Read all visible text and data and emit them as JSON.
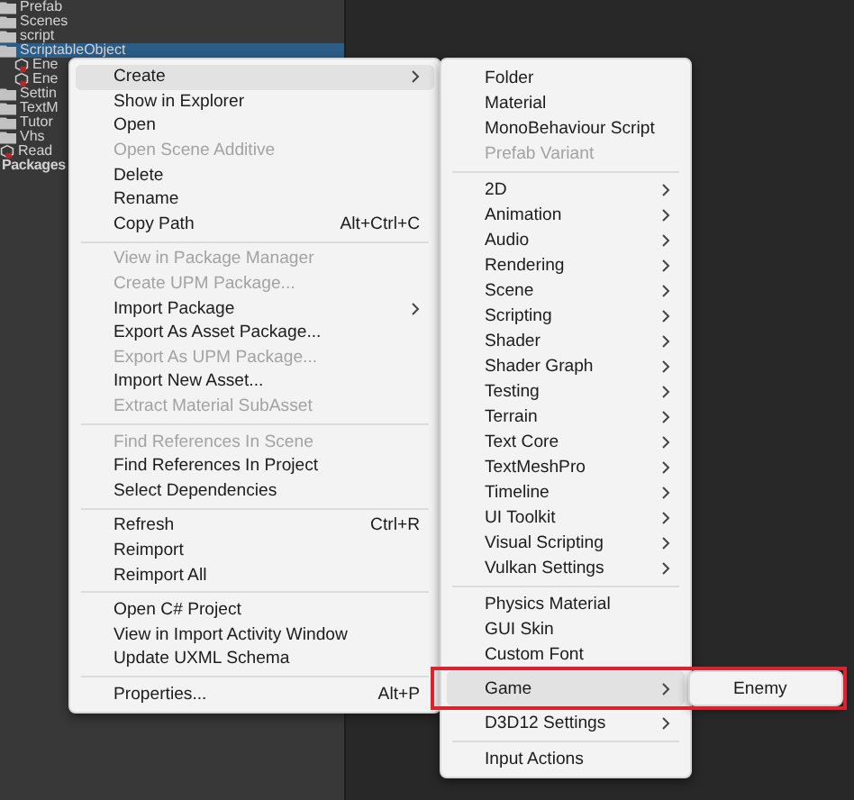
{
  "tree": [
    {
      "label": "Prefab",
      "kind": "folder",
      "selected": false
    },
    {
      "label": "Scenes",
      "kind": "folder",
      "selected": false
    },
    {
      "label": "script",
      "kind": "folder",
      "selected": false
    },
    {
      "label": "ScriptableObject",
      "kind": "folder",
      "selected": true,
      "children": [
        {
          "label": "Ene",
          "kind": "asset",
          "selected": false
        },
        {
          "label": "Ene",
          "kind": "asset",
          "selected": false
        }
      ]
    },
    {
      "label": "Settin",
      "kind": "folder",
      "selected": false
    },
    {
      "label": "TextM",
      "kind": "folder",
      "selected": false
    },
    {
      "label": "Tutor",
      "kind": "folder",
      "selected": false
    },
    {
      "label": "Vhs",
      "kind": "folder",
      "selected": false
    },
    {
      "label": "Read",
      "kind": "asset",
      "selected": false
    },
    {
      "label": "Packages",
      "kind": "header",
      "selected": false
    }
  ],
  "context_menu": {
    "groups": [
      [
        {
          "label": "Create",
          "submenu": true,
          "highlighted": true,
          "disabled": false
        },
        {
          "label": "Show in Explorer",
          "disabled": false
        },
        {
          "label": "Open",
          "disabled": false
        },
        {
          "label": "Open Scene Additive",
          "disabled": true
        },
        {
          "label": "Delete",
          "disabled": false
        },
        {
          "label": "Rename",
          "disabled": false
        },
        {
          "label": "Copy Path",
          "shortcut": "Alt+Ctrl+C",
          "disabled": false
        }
      ],
      [
        {
          "label": "View in Package Manager",
          "disabled": true
        },
        {
          "label": "Create UPM Package...",
          "disabled": true
        },
        {
          "label": "Import Package",
          "submenu": true,
          "disabled": false
        },
        {
          "label": "Export As Asset Package...",
          "disabled": false
        },
        {
          "label": "Export As UPM Package...",
          "disabled": true
        },
        {
          "label": "Import New Asset...",
          "disabled": false
        },
        {
          "label": "Extract Material SubAsset",
          "disabled": true
        }
      ],
      [
        {
          "label": "Find References In Scene",
          "disabled": true
        },
        {
          "label": "Find References In Project",
          "disabled": false
        },
        {
          "label": "Select Dependencies",
          "disabled": false
        }
      ],
      [
        {
          "label": "Refresh",
          "shortcut": "Ctrl+R",
          "disabled": false
        },
        {
          "label": "Reimport",
          "disabled": false
        },
        {
          "label": "Reimport All",
          "disabled": false
        }
      ],
      [
        {
          "label": "Open C# Project",
          "disabled": false
        },
        {
          "label": "View in Import Activity Window",
          "disabled": false
        },
        {
          "label": "Update UXML Schema",
          "disabled": false
        }
      ],
      [
        {
          "label": "Properties...",
          "shortcut": "Alt+P",
          "disabled": false
        }
      ]
    ]
  },
  "create_menu": {
    "groups": [
      [
        {
          "label": "Folder",
          "disabled": false
        },
        {
          "label": "Material",
          "disabled": false
        },
        {
          "label": "MonoBehaviour Script",
          "disabled": false
        },
        {
          "label": "Prefab Variant",
          "disabled": true
        }
      ],
      [
        {
          "label": "2D",
          "submenu": true,
          "disabled": false
        },
        {
          "label": "Animation",
          "submenu": true,
          "disabled": false
        },
        {
          "label": "Audio",
          "submenu": true,
          "disabled": false
        },
        {
          "label": "Rendering",
          "submenu": true,
          "disabled": false
        },
        {
          "label": "Scene",
          "submenu": true,
          "disabled": false
        },
        {
          "label": "Scripting",
          "submenu": true,
          "disabled": false
        },
        {
          "label": "Shader",
          "submenu": true,
          "disabled": false
        },
        {
          "label": "Shader Graph",
          "submenu": true,
          "disabled": false
        },
        {
          "label": "Testing",
          "submenu": true,
          "disabled": false
        },
        {
          "label": "Terrain",
          "submenu": true,
          "disabled": false
        },
        {
          "label": "Text Core",
          "submenu": true,
          "disabled": false
        },
        {
          "label": "TextMeshPro",
          "submenu": true,
          "disabled": false
        },
        {
          "label": "Timeline",
          "submenu": true,
          "disabled": false
        },
        {
          "label": "UI Toolkit",
          "submenu": true,
          "disabled": false
        },
        {
          "label": "Visual Scripting",
          "submenu": true,
          "disabled": false
        },
        {
          "label": "Vulkan Settings",
          "submenu": true,
          "disabled": false
        }
      ],
      [
        {
          "label": "Physics Material",
          "disabled": false
        },
        {
          "label": "GUI Skin",
          "disabled": false
        },
        {
          "label": "Custom Font",
          "disabled": false
        },
        {
          "label": "Game",
          "submenu": true,
          "highlighted": true,
          "disabled": false
        },
        {
          "label": "D3D12 Settings",
          "submenu": true,
          "disabled": false
        }
      ],
      [
        {
          "label": "Input Actions",
          "disabled": false
        }
      ]
    ]
  },
  "game_menu": {
    "groups": [
      [
        {
          "label": "Enemy",
          "disabled": false
        }
      ]
    ]
  },
  "annotation_box": true
}
